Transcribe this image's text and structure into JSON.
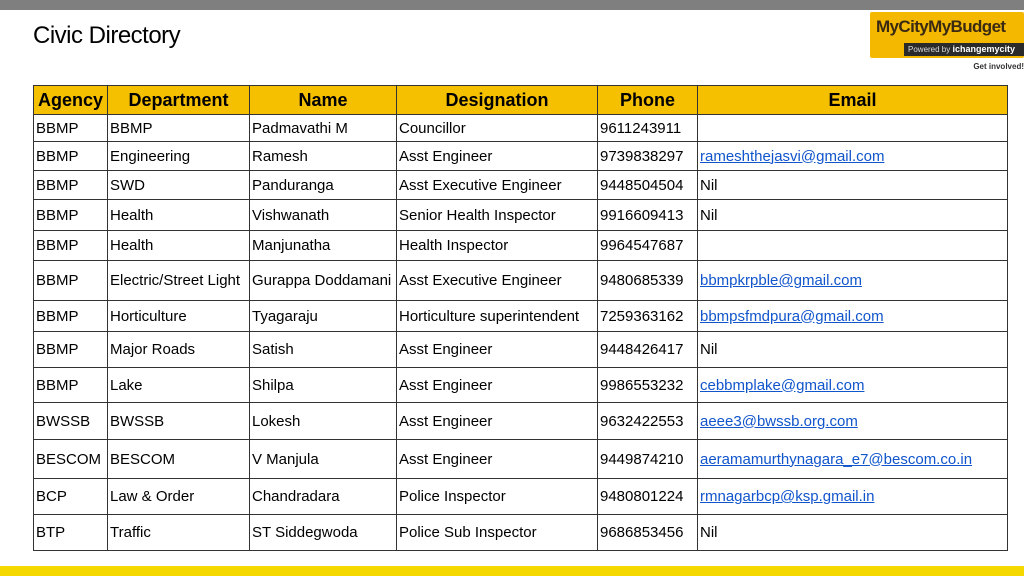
{
  "page": {
    "title": "Civic Directory"
  },
  "logo": {
    "name": "MyCityMyBudget",
    "powered_by": "Powered by",
    "brand": "ichangemycity",
    "tagline": "Get involved!"
  },
  "table": {
    "headers": [
      "Agency",
      "Department",
      "Name",
      "Designation",
      "Phone",
      "Email"
    ],
    "rows": [
      [
        "BBMP",
        "BBMP",
        "Padmavathi M",
        "Councillor",
        "9611243911",
        ""
      ],
      [
        "BBMP",
        "Engineering",
        "Ramesh",
        "Asst Engineer",
        "9739838297",
        "rameshthejasvi@gmail.com"
      ],
      [
        "BBMP",
        "SWD",
        "Panduranga",
        "Asst Executive Engineer",
        "9448504504",
        "Nil"
      ],
      [
        "BBMP",
        "Health",
        "Vishwanath",
        "Senior Health Inspector",
        "9916609413",
        "Nil"
      ],
      [
        "BBMP",
        "Health",
        "Manjunatha",
        "Health Inspector",
        "9964547687",
        ""
      ],
      [
        "BBMP",
        "Electric/Street Light",
        "Gurappa Doddamani",
        "Asst Executive Engineer",
        "9480685339",
        "bbmpkrpble@gmail.com"
      ],
      [
        "BBMP",
        "Horticulture",
        "Tyagaraju",
        "Horticulture superintendent",
        "7259363162",
        "bbmpsfmdpura@gmail.com"
      ],
      [
        "BBMP",
        "Major Roads",
        "Satish",
        "Asst Engineer",
        "9448426417",
        "Nil"
      ],
      [
        "BBMP",
        "Lake",
        "Shilpa",
        "Asst Engineer",
        "9986553232",
        "cebbmplake@gmail.com"
      ],
      [
        "BWSSB",
        "BWSSB",
        "Lokesh",
        "Asst Engineer",
        "9632422553",
        "aeee3@bwssb.org.com"
      ],
      [
        "BESCOM",
        "BESCOM",
        "V Manjula",
        "Asst Engineer",
        "9449874210",
        "aeramamurthynagara_e7@bescom.co.in"
      ],
      [
        "BCP",
        "Law & Order",
        "Chandradara",
        "Police Inspector",
        "9480801224",
        "rmnagarbcp@ksp.gmail.in"
      ],
      [
        "BTP",
        "Traffic",
        "ST Siddegwoda",
        "Police Sub Inspector",
        "9686853456",
        "Nil"
      ]
    ]
  }
}
